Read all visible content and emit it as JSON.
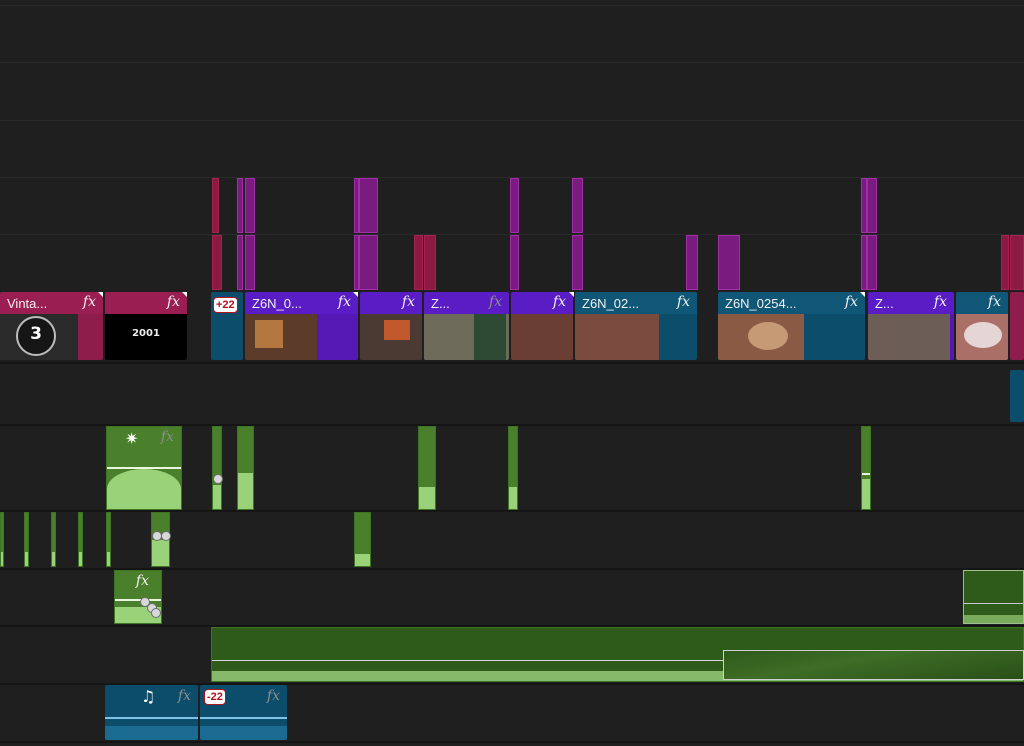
{
  "timeline": {
    "video_clips": [
      {
        "name": "Vinta...",
        "fx": "fx",
        "countdown": "3"
      },
      {
        "name": "",
        "fx": "fx",
        "year_text": "2001"
      },
      {
        "name": "",
        "badge": "+22"
      },
      {
        "name": "Z6N_0...",
        "fx": "fx"
      },
      {
        "name": "",
        "fx": "fx"
      },
      {
        "name": "Z...",
        "fx": "fx"
      },
      {
        "name": "",
        "fx": "fx"
      },
      {
        "name": "Z6N_02...",
        "fx": "fx"
      },
      {
        "name": "Z6N_0254...",
        "fx": "fx"
      },
      {
        "name": "Z...",
        "fx": "fx"
      },
      {
        "name": "",
        "fx": "fx"
      }
    ],
    "audio_clips": {
      "music_clip": {
        "icon": "music-note-icon",
        "fx": "fx"
      },
      "music_clip_2": {
        "badge": "-22",
        "fx": "fx"
      },
      "effect_clip": {
        "fx": "fx"
      },
      "sparkle_clip": {
        "fx": "fx"
      }
    },
    "colors": {
      "title_clip": "#9b1e52",
      "purple_clip": "#5a1cc4",
      "teal_clip": "#0f5677",
      "audio_clip": "#2e5a1a",
      "waveform": "#9ad27a"
    }
  }
}
